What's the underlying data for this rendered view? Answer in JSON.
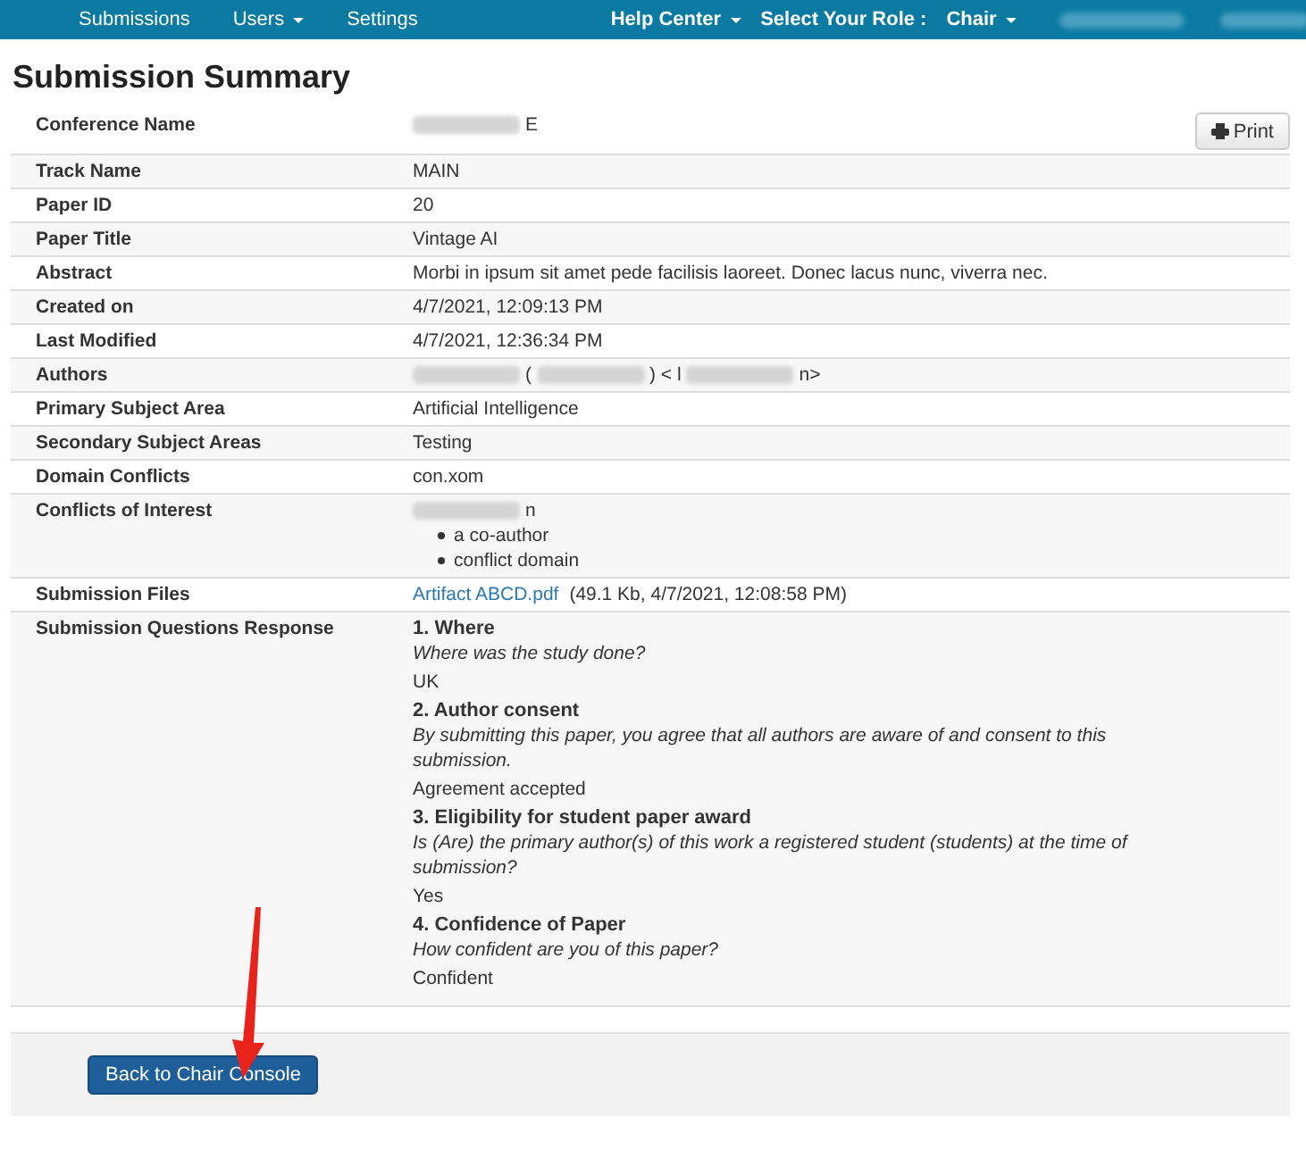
{
  "navbar": {
    "items": [
      {
        "label": "Submissions",
        "dropdown": false
      },
      {
        "label": "Users",
        "dropdown": true
      },
      {
        "label": "Settings",
        "dropdown": false
      }
    ],
    "right_items": [
      {
        "kind": "link",
        "label": "Help Center",
        "dropdown": true
      },
      {
        "kind": "text",
        "label": "Select Your Role :"
      },
      {
        "kind": "link",
        "label": "Chair",
        "dropdown": true
      },
      {
        "kind": "redacted"
      },
      {
        "kind": "redacted"
      }
    ]
  },
  "page_title": "Submission Summary",
  "print_button": "Print",
  "rows": [
    {
      "label": "Conference Name",
      "kind": "parts",
      "parts": [
        {
          "kind": "redacted"
        },
        {
          "kind": "text",
          "text": "E"
        }
      ]
    },
    {
      "label": "Track Name",
      "kind": "text",
      "value": "MAIN"
    },
    {
      "label": "Paper ID",
      "kind": "text",
      "value": "20"
    },
    {
      "label": "Paper Title",
      "kind": "text",
      "value": "Vintage AI"
    },
    {
      "label": "Abstract",
      "kind": "text",
      "value": "Morbi in ipsum sit amet pede facilisis laoreet. Donec lacus nunc, viverra nec."
    },
    {
      "label": "Created on",
      "kind": "text",
      "value": "4/7/2021, 12:09:13 PM"
    },
    {
      "label": "Last Modified",
      "kind": "text",
      "value": "4/7/2021, 12:36:34 PM"
    },
    {
      "label": "Authors",
      "kind": "parts",
      "parts": [
        {
          "kind": "redacted"
        },
        {
          "kind": "text",
          "text": "("
        },
        {
          "kind": "redacted"
        },
        {
          "kind": "text",
          "text": ") < l"
        },
        {
          "kind": "redacted"
        },
        {
          "kind": "text",
          "text": "n>"
        }
      ]
    },
    {
      "label": "Primary Subject Area",
      "kind": "text",
      "value": "Artificial Intelligence"
    },
    {
      "label": "Secondary Subject Areas",
      "kind": "text",
      "value": "Testing"
    },
    {
      "label": "Domain Conflicts",
      "kind": "text",
      "value": "con.xom"
    },
    {
      "label": "Conflicts of Interest",
      "kind": "conflicts",
      "parts": [
        {
          "kind": "redacted"
        },
        {
          "kind": "text",
          "text": "n"
        }
      ],
      "reasons": [
        "a co-author",
        "conflict domain"
      ]
    },
    {
      "label": "Submission Files",
      "kind": "file",
      "link": "Artifact ABCD.pdf",
      "detail": "(49.1 Kb, 4/7/2021, 12:08:58 PM)"
    },
    {
      "label": "Submission Questions Response",
      "kind": "questions",
      "questions": [
        {
          "title": "1. Where",
          "prompt": "Where was the study done?",
          "answer": "UK"
        },
        {
          "title": "2. Author consent",
          "prompt": "By submitting this paper, you agree that all authors are aware of and consent to this submission.",
          "answer": "Agreement accepted"
        },
        {
          "title": "3. Eligibility for student paper award",
          "prompt": "Is (Are) the primary author(s) of this work a registered student (students) at the time of submission?",
          "answer": "Yes"
        },
        {
          "title": "4. Confidence of Paper",
          "prompt": "How confident are you of this paper?",
          "answer": "Confident"
        }
      ]
    }
  ],
  "back_button": "Back to Chair Console"
}
